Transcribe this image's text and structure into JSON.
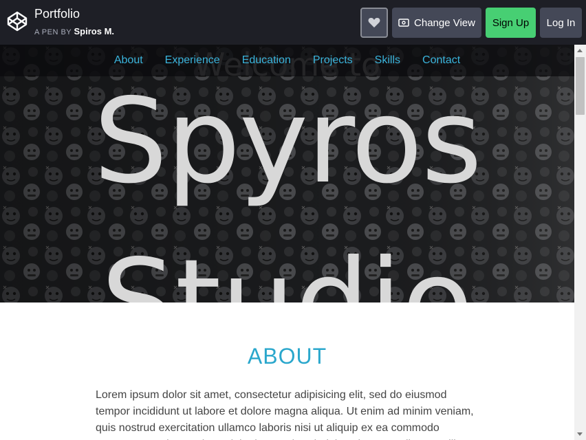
{
  "header": {
    "title": "Portfolio",
    "by_prefix": "A PEN BY",
    "author": "Spiros M.",
    "buttons": {
      "change_view": "Change View",
      "sign_up": "Sign Up",
      "log_in": "Log In"
    },
    "icons": {
      "logo": "codepen-logo-icon",
      "heart": "heart-icon",
      "view": "eye-icon"
    }
  },
  "nav": {
    "items": [
      {
        "label": "About"
      },
      {
        "label": "Experience"
      },
      {
        "label": "Education"
      },
      {
        "label": "Projects"
      },
      {
        "label": "Skills"
      },
      {
        "label": "Contact"
      }
    ]
  },
  "hero": {
    "welcome": "Welcome to",
    "name": "Spyros",
    "studio": "Studio"
  },
  "about": {
    "heading": "ABOUT",
    "text": "Lorem ipsum dolor sit amet, consectetur adipisicing elit, sed do eiusmod tempor incididunt ut labore et dolore magna aliqua. Ut enim ad minim veniam, quis nostrud exercitation ullamco laboris nisi ut aliquip ex ea commodo consequat. Duis aute irure dolor in reprehenderit in voluptate velit esse cillum"
  },
  "colors": {
    "header_bg": "#1e1f26",
    "accent": "#2aa7cc",
    "signup": "#47cf73"
  }
}
